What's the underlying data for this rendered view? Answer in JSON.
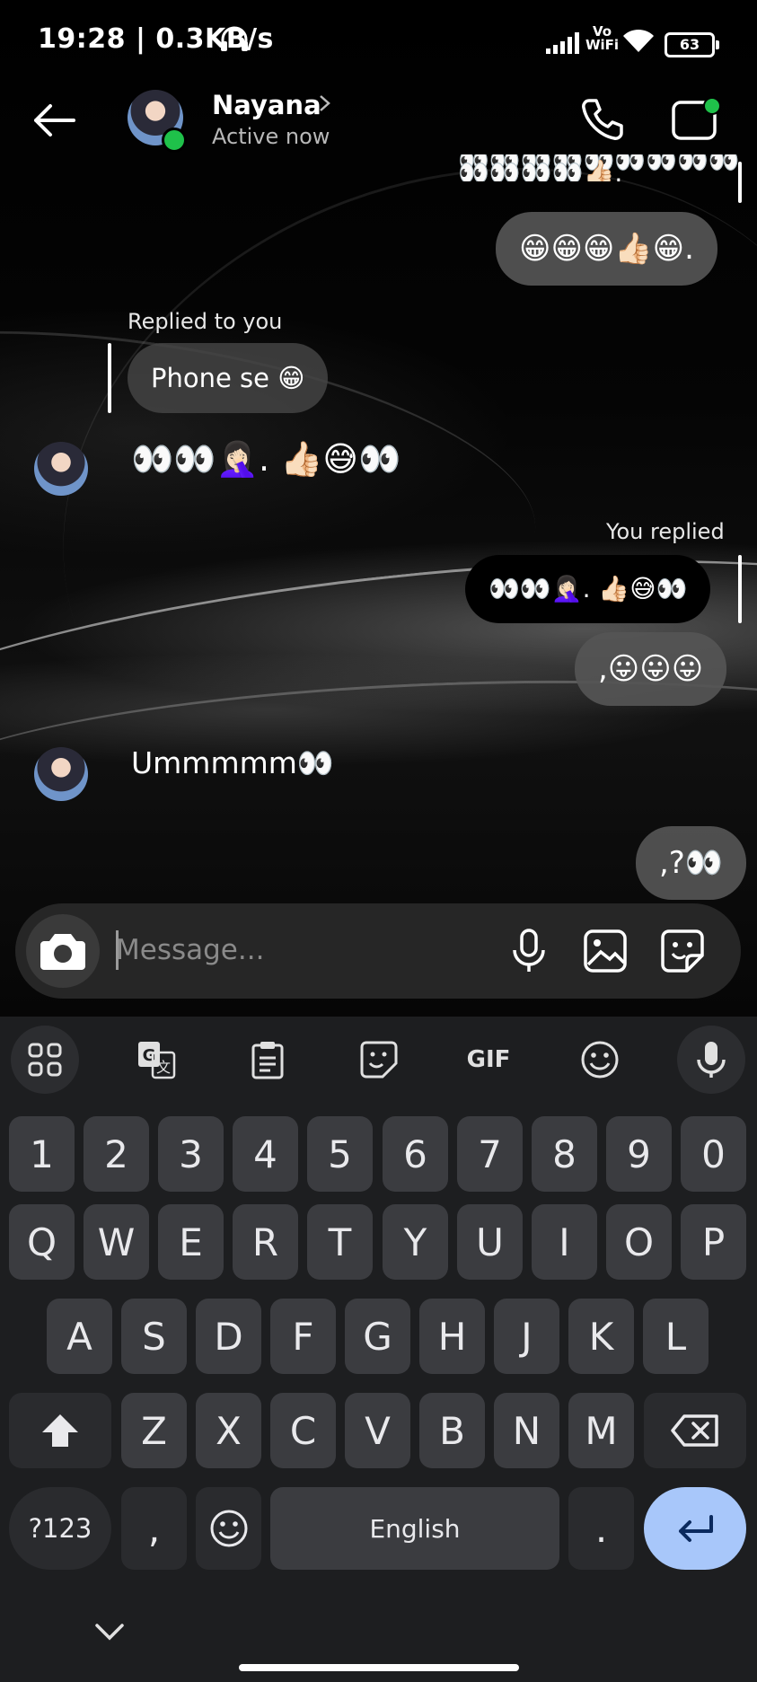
{
  "status_bar": {
    "time_speed": "19:28 | 0.3KB/s",
    "network_label_top": "Vo",
    "network_label_bottom": "WiFi",
    "battery": "63"
  },
  "header": {
    "contact_name": "Nayana",
    "presence": "Active now"
  },
  "messages": {
    "m1_partial": "👀👀👀👀👀👀👀👀👀👀👀👀👀👍🏻.",
    "m2": "😁😁😁👍🏻😁.",
    "m3_reply_label": "Replied to you",
    "m3": "Phone se 😁",
    "m4": "👀👀🤦🏻‍♀️. 👍🏻😅👀",
    "m5_reply_label": "You replied",
    "m5": "👀👀🤦🏻‍♀️. 👍🏻😅👀",
    "m6": ",😛😛😛",
    "m7": "Ummmmm👀",
    "m8": ",?👀"
  },
  "composer": {
    "placeholder": "Message..."
  },
  "keyboard": {
    "row_numbers": [
      "1",
      "2",
      "3",
      "4",
      "5",
      "6",
      "7",
      "8",
      "9",
      "0"
    ],
    "row_q": [
      "Q",
      "W",
      "E",
      "R",
      "T",
      "Y",
      "U",
      "I",
      "O",
      "P"
    ],
    "row_a": [
      "A",
      "S",
      "D",
      "F",
      "G",
      "H",
      "J",
      "K",
      "L"
    ],
    "row_z": [
      "Z",
      "X",
      "C",
      "V",
      "B",
      "N",
      "M"
    ],
    "symbols_key": "?123",
    "comma_key": ",",
    "space_label": "English",
    "period_key": ".",
    "gif_label": "GIF"
  },
  "colors": {
    "enter_key": "#a8c7fa",
    "online_dot": "#1fc14a",
    "keyboard_bg": "#1d1e20",
    "key_bg": "#3b3c40"
  }
}
